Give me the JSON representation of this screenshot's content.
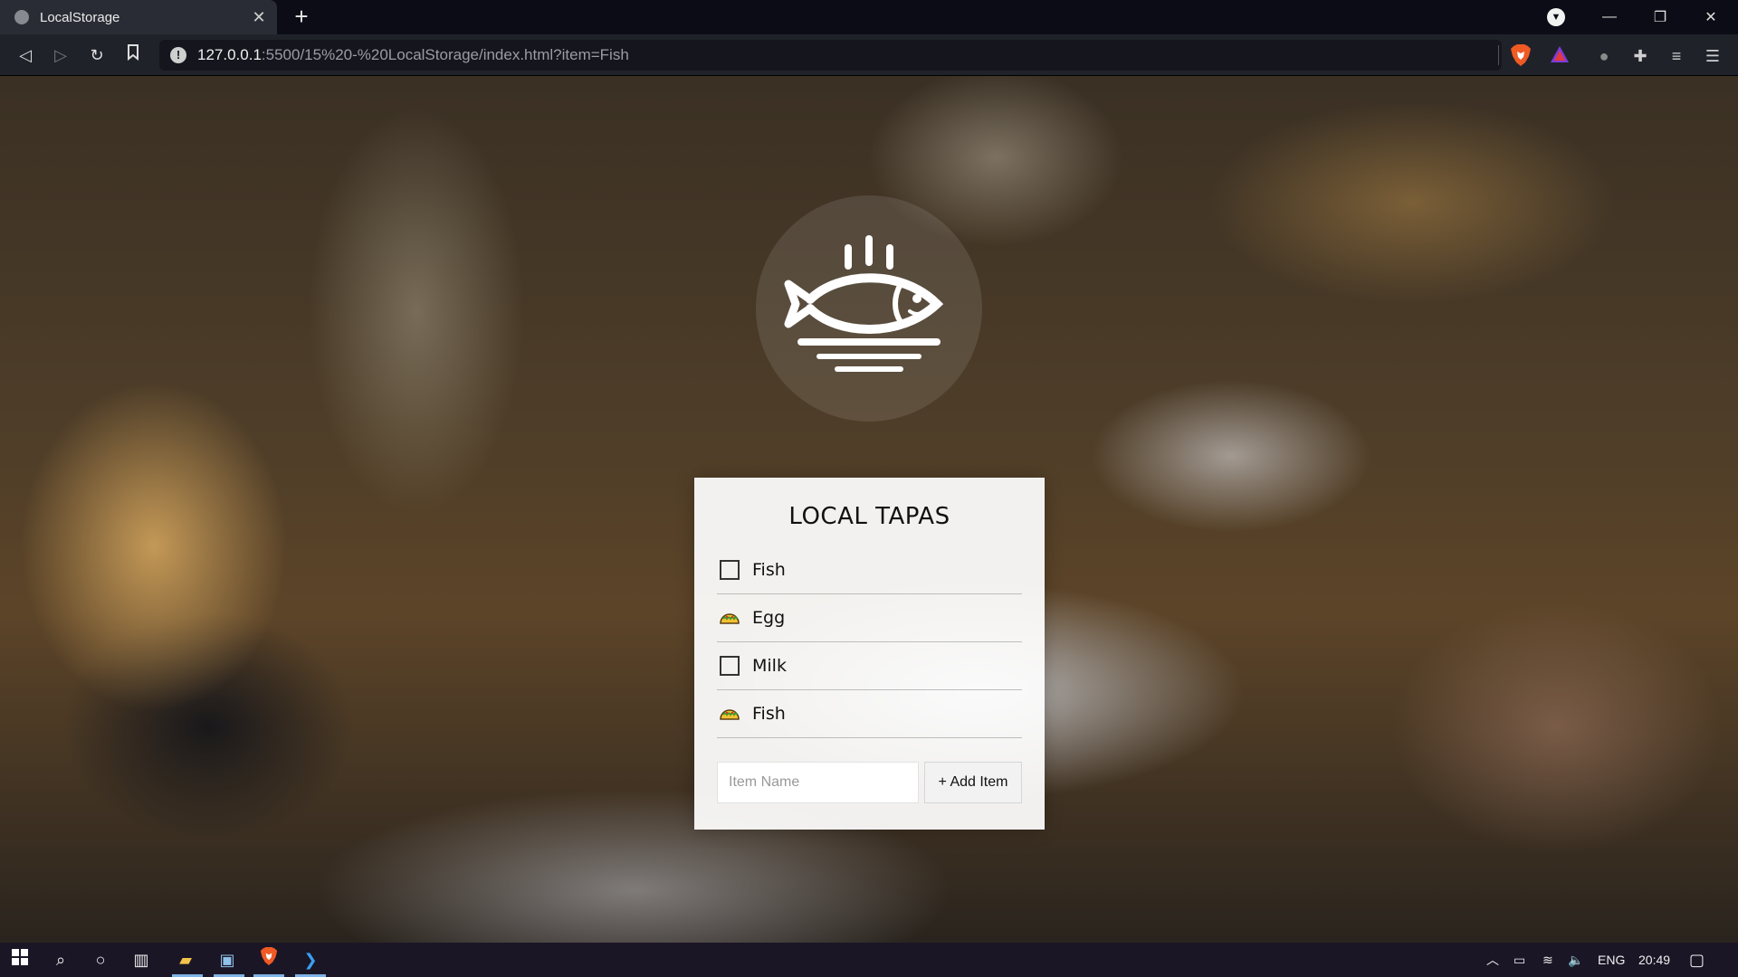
{
  "browser": {
    "tab_title": "LocalStorage",
    "tab_close": "✕",
    "new_tab": "+",
    "url_host": "127.0.0.1",
    "url_path": ":5500/15%20-%20LocalStorage/index.html?item=Fish",
    "window_controls": {
      "minimize": "—",
      "restore": "❐",
      "close": "✕"
    },
    "nav": {
      "back": "◁",
      "forward": "▷",
      "reload": "↻",
      "bookmark": "🔖"
    }
  },
  "app": {
    "title": "LOCAL TAPAS",
    "items": [
      {
        "label": "Fish",
        "done": false
      },
      {
        "label": "Egg",
        "done": true
      },
      {
        "label": "Milk",
        "done": false
      },
      {
        "label": "Fish",
        "done": true
      }
    ],
    "input_placeholder": "Item Name",
    "add_button": "+ Add Item"
  },
  "taskbar": {
    "language": "ENG",
    "time": "20:49"
  },
  "icons": {
    "logo": "fish-on-plate-icon",
    "done_marker": "taco-icon"
  },
  "colors": {
    "accent_taskbar": "#7fb2e5",
    "card_bg": "#ffffff"
  }
}
